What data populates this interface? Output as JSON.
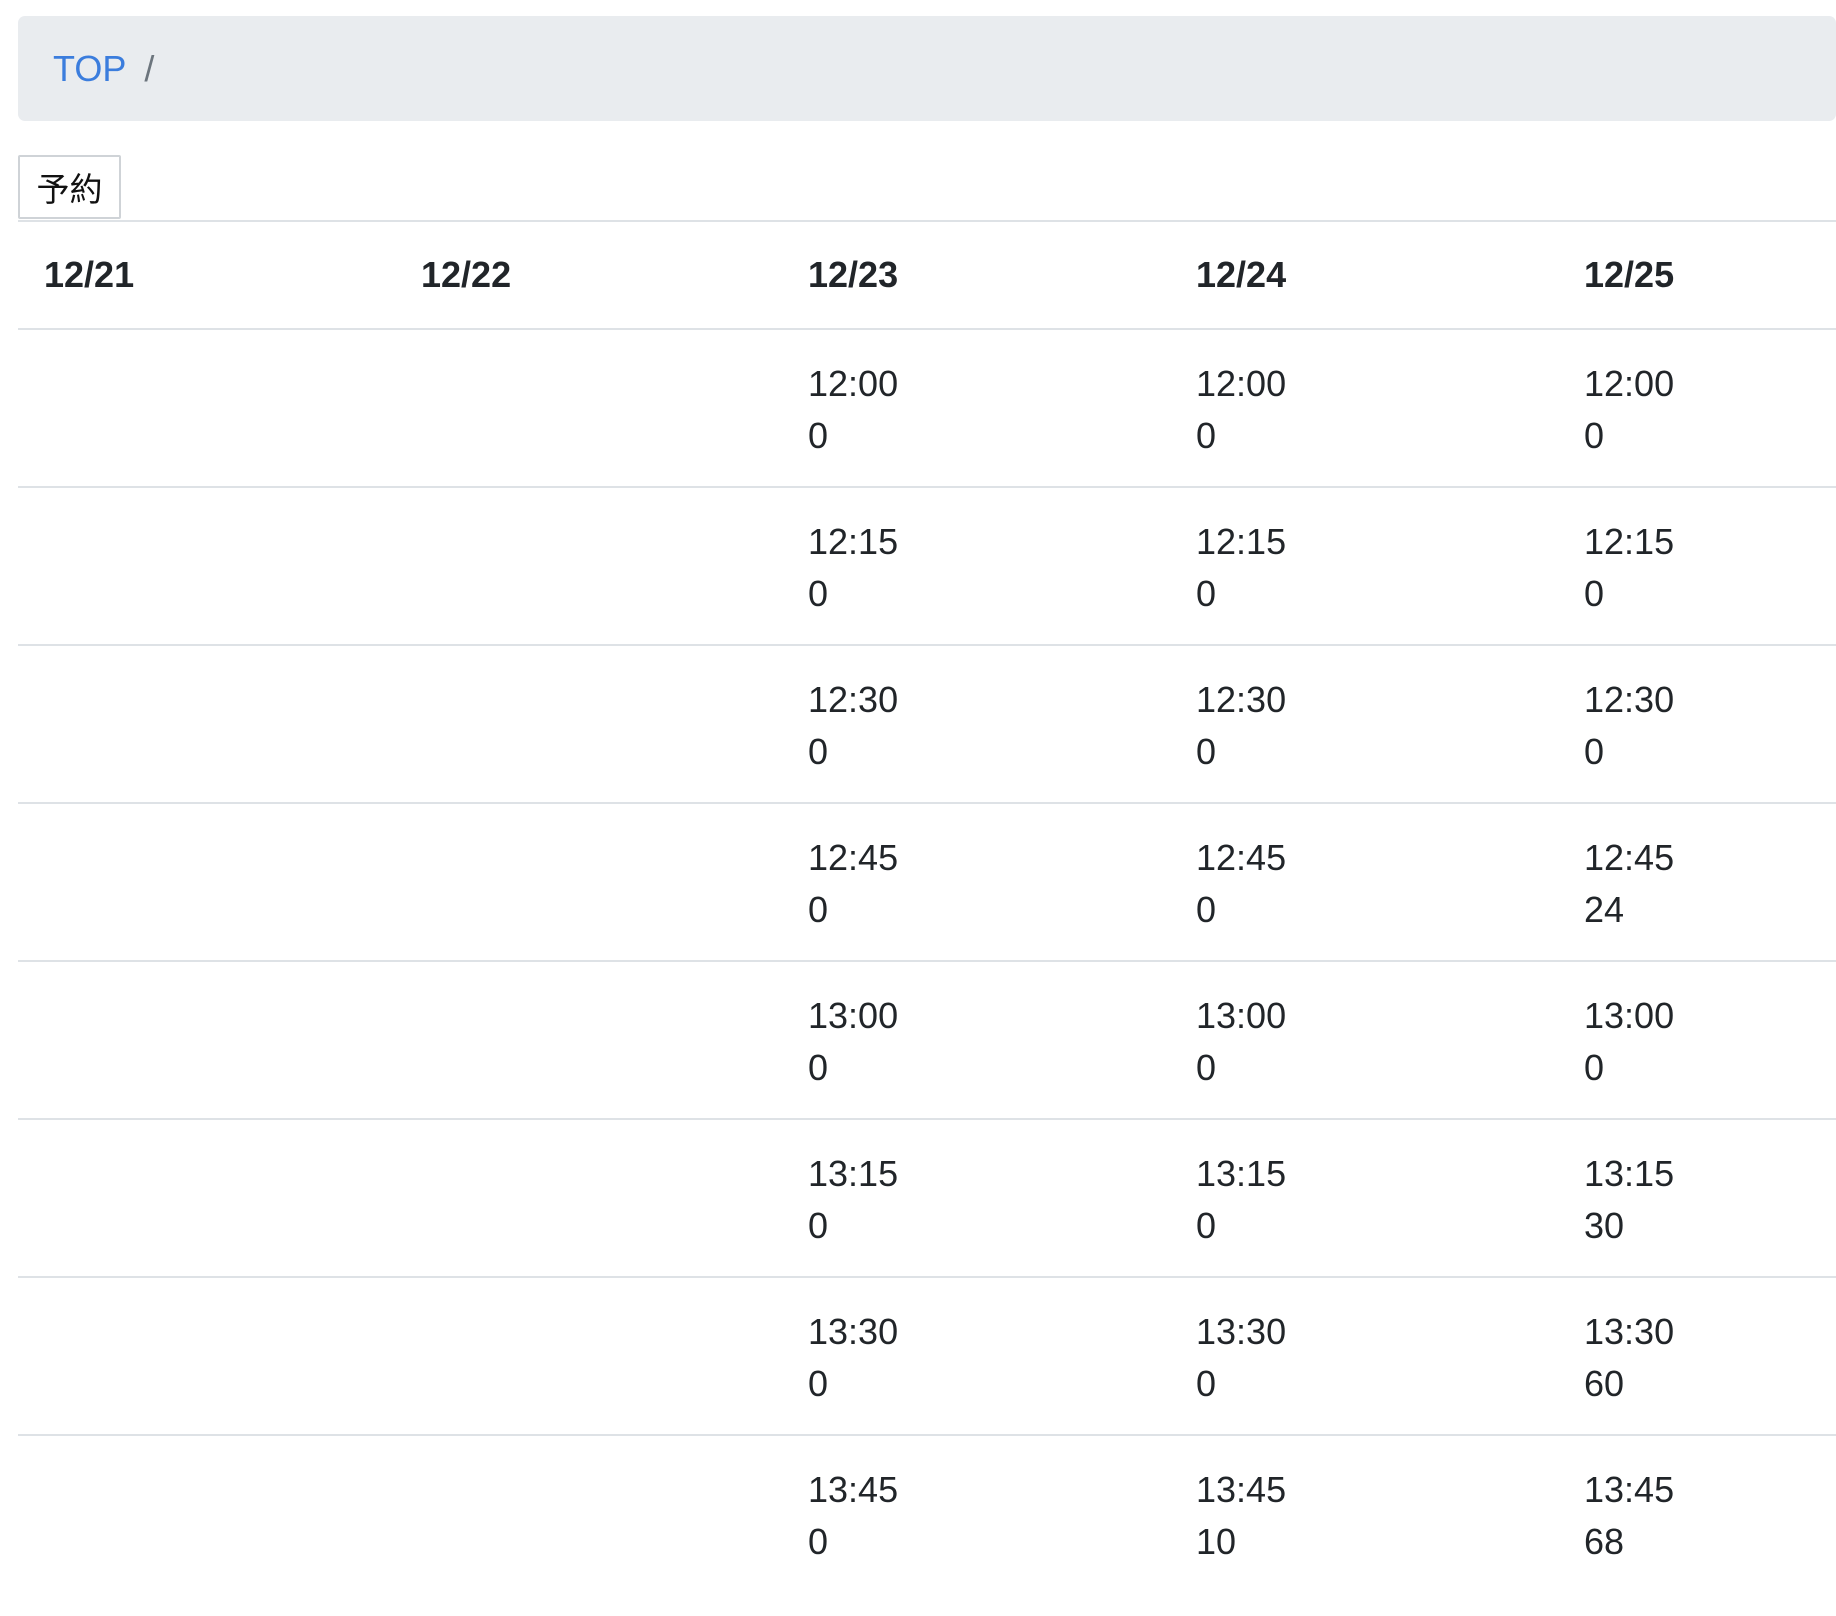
{
  "breadcrumb": {
    "items": [
      {
        "label": "TOP"
      }
    ],
    "separator": "/"
  },
  "toolbar": {
    "reserve_label": "予約"
  },
  "schedule": {
    "dates": [
      "12/21",
      "12/22",
      "12/23",
      "12/24",
      "12/25"
    ],
    "rows": [
      [
        "",
        "",
        {
          "time": "12:00",
          "count": "0"
        },
        {
          "time": "12:00",
          "count": "0"
        },
        {
          "time": "12:00",
          "count": "0"
        }
      ],
      [
        "",
        "",
        {
          "time": "12:15",
          "count": "0"
        },
        {
          "time": "12:15",
          "count": "0"
        },
        {
          "time": "12:15",
          "count": "0"
        }
      ],
      [
        "",
        "",
        {
          "time": "12:30",
          "count": "0"
        },
        {
          "time": "12:30",
          "count": "0"
        },
        {
          "time": "12:30",
          "count": "0"
        }
      ],
      [
        "",
        "",
        {
          "time": "12:45",
          "count": "0"
        },
        {
          "time": "12:45",
          "count": "0"
        },
        {
          "time": "12:45",
          "count": "24"
        }
      ],
      [
        "",
        "",
        {
          "time": "13:00",
          "count": "0"
        },
        {
          "time": "13:00",
          "count": "0"
        },
        {
          "time": "13:00",
          "count": "0"
        }
      ],
      [
        "",
        "",
        {
          "time": "13:15",
          "count": "0"
        },
        {
          "time": "13:15",
          "count": "0"
        },
        {
          "time": "13:15",
          "count": "30"
        }
      ],
      [
        "",
        "",
        {
          "time": "13:30",
          "count": "0"
        },
        {
          "time": "13:30",
          "count": "0"
        },
        {
          "time": "13:30",
          "count": "60"
        }
      ],
      [
        "",
        "",
        {
          "time": "13:45",
          "count": "0"
        },
        {
          "time": "13:45",
          "count": "10"
        },
        {
          "time": "13:45",
          "count": "68"
        }
      ]
    ]
  },
  "colors": {
    "breadcrumb_bg": "#e9ecef",
    "link": "#3b7ddd",
    "text": "#212529",
    "border": "#dee2e6"
  }
}
